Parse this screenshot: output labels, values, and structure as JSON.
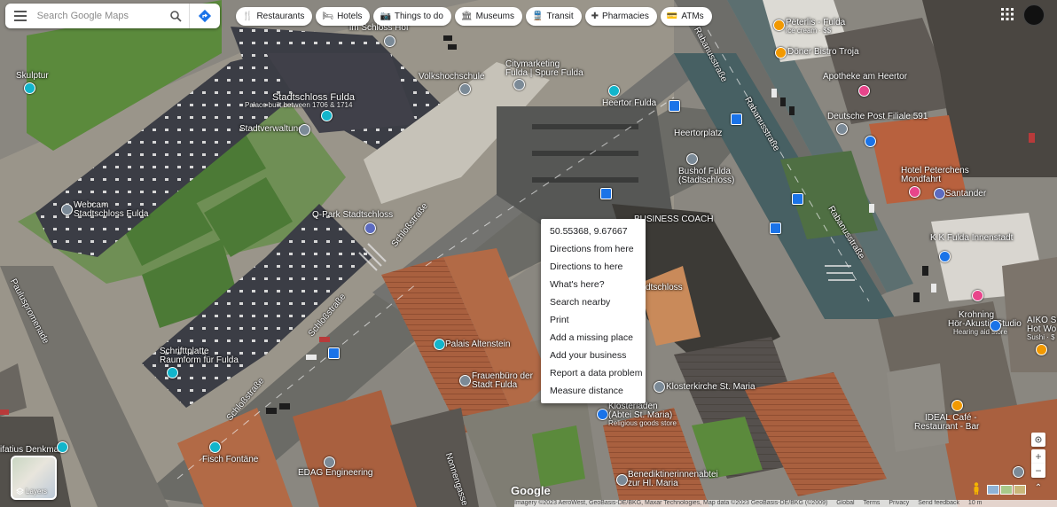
{
  "search": {
    "placeholder": "Search Google Maps"
  },
  "chips": [
    {
      "icon": "restaurant-icon",
      "glyph": "🍴",
      "label": "Restaurants"
    },
    {
      "icon": "hotel-icon",
      "glyph": "🛏",
      "label": "Hotels"
    },
    {
      "icon": "camera-icon",
      "glyph": "📷",
      "label": "Things to do"
    },
    {
      "icon": "museum-icon",
      "glyph": "🏛",
      "label": "Museums"
    },
    {
      "icon": "transit-icon",
      "glyph": "🚆",
      "label": "Transit"
    },
    {
      "icon": "pharmacy-icon",
      "glyph": "✚",
      "label": "Pharmacies"
    },
    {
      "icon": "atm-icon",
      "glyph": "💳",
      "label": "ATMs"
    }
  ],
  "context_menu": {
    "coordinates": "50.55368, 9.67667",
    "items": [
      "Directions from here",
      "Directions to here",
      "What's here?",
      "Search nearby",
      "Print",
      "Add a missing place",
      "Add your business",
      "Report a data problem",
      "Measure distance"
    ]
  },
  "map": {
    "places": {
      "skulptur": "Skulptur",
      "im_schloss_hof": "im Schloss Hof",
      "stadtschloss": "Stadtschloss Fulda",
      "stadtschloss_sub": "Palace built between 1706 & 1714",
      "stadtverwaltung": "Stadtverwaltung",
      "volkshochschule": "Volkshochschule",
      "citymarketing": "Citymarketing",
      "citymarketing2": "Fulda | Spure Fulda",
      "heertor_fulda": "Heertor Fulda",
      "heertorplatz": "Heertorplatz",
      "bushof": "Bushof Fulda",
      "bushof2": "(Stadtschloss)",
      "business_coach": "BUSINESS COACH",
      "webcam": "Webcam",
      "webcam2": "Stadtschloss Fulda",
      "qpark": "Q-Park Stadtschloss",
      "palais": "Palais Altenstein",
      "frauenbuero": "Frauenbüro der",
      "frauenbuero2": "Stadt Fulda",
      "schrifttplatte": "Schrifttplatte",
      "schrifttplatte2": "Raumform für Fulda",
      "klosterkirche": "Klosterkirche St. Maria",
      "klosterladen": "Klosterladen",
      "klosterladen2": "(Abtei St. Maria)",
      "klosterladen_sub": "Religious goods store",
      "benediktinerinnen": "Benediktinerinnenabtei",
      "benediktinerinnen2": "zur Hl. Maria",
      "edag": "EDAG Engineering",
      "fisch": "Fisch Fontäne",
      "denkmal": "ifatius Denkmal",
      "schloss_partial": "dtschloss",
      "peperis": "Pëterlis - Fulda",
      "peperis_sub": "Ice cream · $$",
      "bistro": "Döner Bistro Troja",
      "apotheke": "Apotheke am Heertor",
      "post": "Deutsche Post Filiale 591",
      "peterchens": "Hotel Peterchens",
      "peterchens2": "Mondfahrt",
      "santander": "Santander",
      "kk": "K K Fulda Innenstadt",
      "krohning": "Krohning",
      "krohning2": "Hör-Akustik Studio",
      "krohning_sub": "Hearing aid store",
      "aiko": "AIKO Su",
      "aiko2": "Hot Wo",
      "aiko_sub": "Sushi · $",
      "ideal": "IDEAL Café -",
      "ideal2": "Restaurant - Bar"
    },
    "roads": {
      "rabanusstrasse": "Rabanusstraße",
      "schlossstrasse": "Schloßstraße",
      "paulustpromenade": "Pauluspromenade",
      "nonnengasse": "Nonnengasse"
    }
  },
  "layers": {
    "label": "Layers"
  },
  "footer": {
    "google": "Google",
    "imagery": "Imagery ©2023 AeroWest, GeoBasis-DE/BKG, Maxar Technologies, Map data ©2023 GeoBasis-DE/BKG (©2009)",
    "global": "Global",
    "terms": "Terms",
    "privacy": "Privacy",
    "feedback": "Send feedback",
    "scale": "10 m"
  },
  "controls": {
    "zoom_in": "+",
    "zoom_out": "−",
    "expand": "⌃"
  },
  "colors": {
    "pin_blue": "#1a73e8",
    "pin_teal": "#12b5cb",
    "pin_gray": "#7b8a97",
    "pin_pink": "#e8458b",
    "pin_orange": "#f29900",
    "roof_red": "#a3583a",
    "roof_dark": "#3a3b42",
    "grass": "#4c7a36",
    "asphalt": "#6b6b66"
  }
}
